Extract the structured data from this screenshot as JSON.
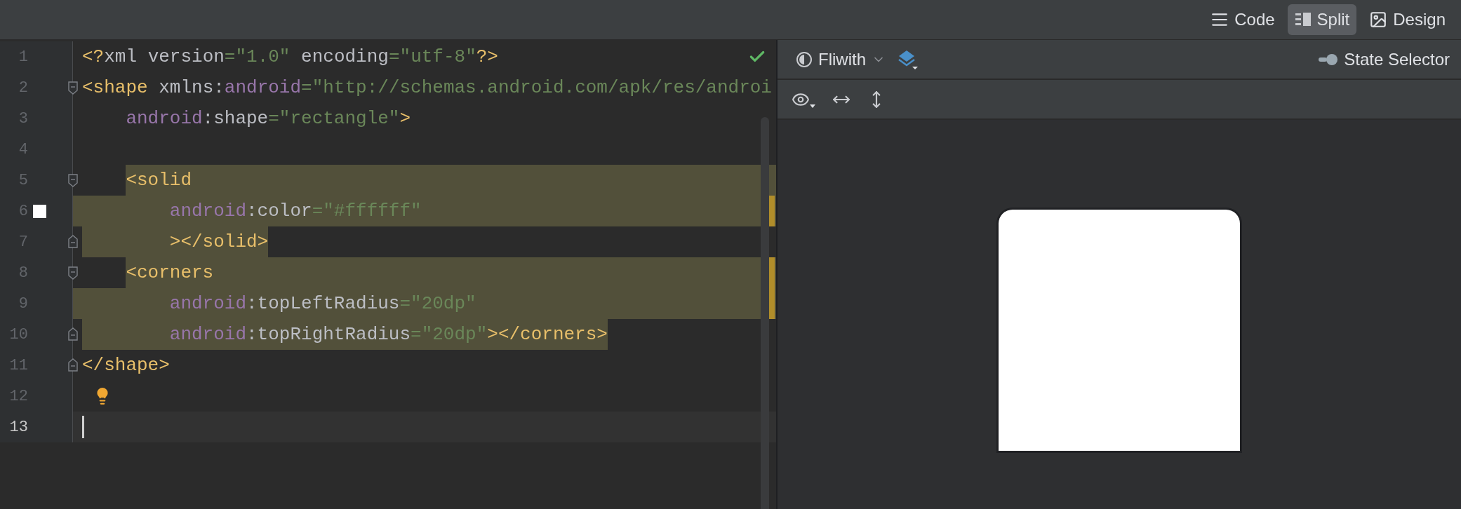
{
  "view_modes": [
    {
      "label": "Code",
      "kind": "code",
      "selected": false
    },
    {
      "label": "Split",
      "kind": "split",
      "selected": true
    },
    {
      "label": "Design",
      "kind": "design",
      "selected": false
    }
  ],
  "editor": {
    "valid": true,
    "lines": [
      {
        "number": "1",
        "kind": "plain",
        "selected": false,
        "current": false,
        "bulb": false,
        "stripe": false,
        "tokens": [
          {
            "text": "<?",
            "kind": "tag"
          },
          {
            "text": "xml version",
            "kind": "name"
          },
          {
            "text": "=\"1.0\"",
            "kind": "string"
          },
          {
            "text": " encoding",
            "kind": "name"
          },
          {
            "text": "=\"utf-8\"",
            "kind": "string"
          },
          {
            "text": "?>",
            "kind": "tag"
          }
        ]
      },
      {
        "number": "2",
        "gutter": {
          "kind": "fold_start"
        },
        "kind": "plain",
        "selected": false,
        "current": false,
        "bulb": false,
        "stripe": false,
        "tokens": [
          {
            "text": "<shape",
            "kind": "tag"
          },
          {
            "text": " xmlns:",
            "kind": "name"
          },
          {
            "text": "android",
            "kind": "ns"
          },
          {
            "text": "=\"http://schemas.android.com/apk/res/androi",
            "kind": "string"
          }
        ]
      },
      {
        "number": "3",
        "kind": "plain",
        "selected": false,
        "current": false,
        "bulb": false,
        "stripe": false,
        "tokens": [
          {
            "text": "    android",
            "kind": "ns"
          },
          {
            "text": ":shape",
            "kind": "name"
          },
          {
            "text": "=\"rectangle\"",
            "kind": "string"
          },
          {
            "text": ">",
            "kind": "tag"
          }
        ]
      },
      {
        "number": "4",
        "kind": "plain",
        "selected": false,
        "current": false,
        "bulb": false,
        "stripe": false
      },
      {
        "number": "5",
        "gutter": {
          "kind": "fold_start"
        },
        "kind": "block_start",
        "selected": true,
        "current": false,
        "bulb": false,
        "stripe": false,
        "tokens": [
          {
            "text": "    <solid",
            "kind": "tag"
          }
        ]
      },
      {
        "number": "6",
        "gutter": {
          "kind": "swatch"
        },
        "kind": "block_middle",
        "selected": true,
        "current": false,
        "bulb": false,
        "stripe": true,
        "tokens": [
          {
            "text": "        android",
            "kind": "ns"
          },
          {
            "text": ":color",
            "kind": "name"
          },
          {
            "text": "=\"#ffffff\"",
            "kind": "string"
          }
        ]
      },
      {
        "number": "7",
        "gutter": {
          "kind": "fold_end"
        },
        "kind": "block_end",
        "selected": true,
        "current": false,
        "bulb": false,
        "stripe": false,
        "tokens": [
          {
            "text": "        ></solid>",
            "kind": "tag"
          }
        ]
      },
      {
        "number": "8",
        "gutter": {
          "kind": "fold_start"
        },
        "kind": "block_start",
        "selected": true,
        "current": false,
        "bulb": false,
        "stripe": true,
        "tokens": [
          {
            "text": "    <corners",
            "kind": "tag"
          }
        ]
      },
      {
        "number": "9",
        "kind": "block_middle",
        "selected": true,
        "current": false,
        "bulb": false,
        "stripe": true,
        "tokens": [
          {
            "text": "        android",
            "kind": "ns"
          },
          {
            "text": ":topLeftRadius",
            "kind": "name"
          },
          {
            "text": "=\"20dp\"",
            "kind": "string"
          }
        ]
      },
      {
        "number": "10",
        "gutter": {
          "kind": "fold_end"
        },
        "kind": "block_end",
        "selected": true,
        "current": false,
        "bulb": false,
        "stripe": false,
        "tokens": [
          {
            "text": "        android",
            "kind": "ns"
          },
          {
            "text": ":topRightRadius",
            "kind": "name"
          },
          {
            "text": "=\"20dp\"",
            "kind": "string"
          },
          {
            "text": "></corners>",
            "kind": "tag"
          }
        ]
      },
      {
        "number": "11",
        "gutter": {
          "kind": "fold_end"
        },
        "kind": "plain",
        "selected": false,
        "current": false,
        "bulb": false,
        "stripe": false,
        "tokens": [
          {
            "text": "</shape>",
            "kind": "tag"
          }
        ]
      },
      {
        "number": "12",
        "kind": "plain",
        "selected": false,
        "current": false,
        "bulb": true,
        "stripe": false
      },
      {
        "number": "13",
        "kind": "plain",
        "selected": false,
        "current": true,
        "bulb": false,
        "stripe": false
      }
    ]
  },
  "preview": {
    "theme": "Fliwith",
    "state_selector": "State Selector"
  }
}
